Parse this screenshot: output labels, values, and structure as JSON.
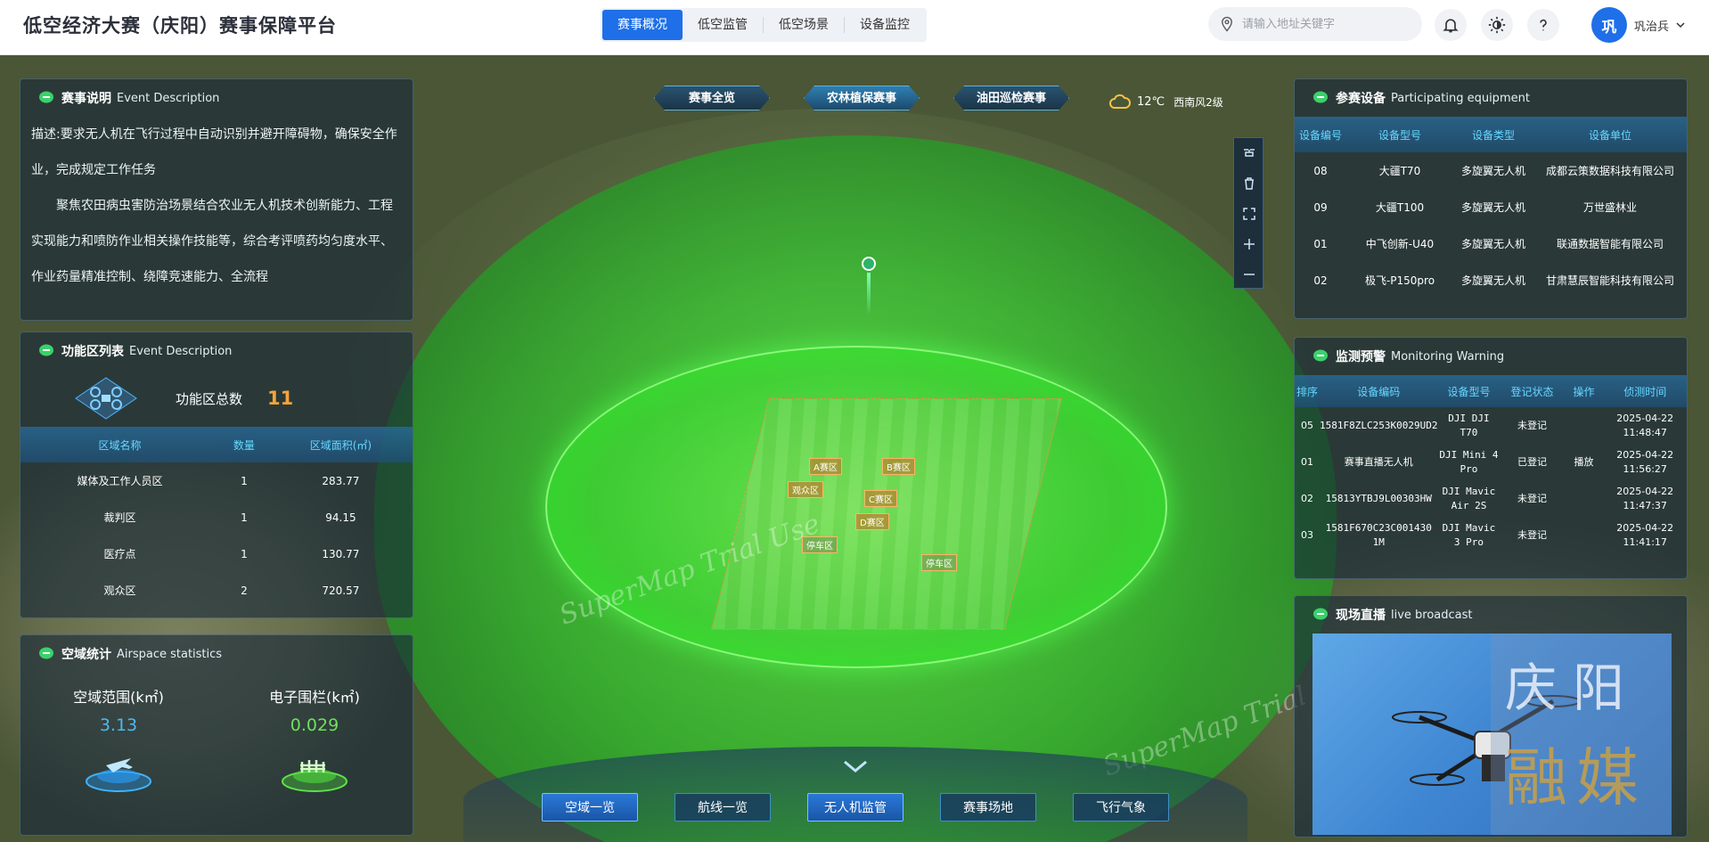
{
  "header": {
    "title": "低空经济大赛（庆阳）赛事保障平台",
    "nav": [
      {
        "label": "赛事概况",
        "active": true
      },
      {
        "label": "低空监管",
        "active": false
      },
      {
        "label": "低空场景",
        "active": false
      },
      {
        "label": "设备监控",
        "active": false
      }
    ],
    "search_placeholder": "请输入地址关键字",
    "user": {
      "avatar": "巩",
      "name": "巩治兵"
    }
  },
  "event_desc": {
    "title": "赛事说明",
    "title_en": "Event Description",
    "para1": "描述:要求无人机在飞行过程中自动识别并避开障碍物，确保安全作业，完成规定工作任务",
    "para2": "聚焦农田病虫害防治场景结合农业无人机技术创新能力、工程实现能力和喷防作业相关操作技能等，综合考评喷药均匀度水平、作业药量精准控制、绕障竞速能力、全流程"
  },
  "func_list": {
    "title": "功能区列表",
    "title_en": "Event Description",
    "total_label": "功能区总数",
    "total": "11",
    "columns": [
      "区域名称",
      "数量",
      "区域面积(㎡)"
    ],
    "rows": [
      [
        "媒体及工作人员区",
        "1",
        "283.77"
      ],
      [
        "裁判区",
        "1",
        "94.15"
      ],
      [
        "医疗点",
        "1",
        "130.77"
      ],
      [
        "观众区",
        "2",
        "720.57"
      ]
    ]
  },
  "airspace": {
    "title": "空域统计",
    "title_en": "Airspace statistics",
    "range_label": "空域范围(k㎡)",
    "range_value": "3.13",
    "fence_label": "电子围栏(k㎡)",
    "fence_value": "0.029",
    "colors": {
      "range": "#4fb8f0",
      "fence": "#6ee05a"
    }
  },
  "scene_tabs": [
    {
      "label": "赛事全览",
      "active": false
    },
    {
      "label": "农林植保赛事",
      "active": true
    },
    {
      "label": "油田巡检赛事",
      "active": false
    }
  ],
  "weather": {
    "temp": "12℃",
    "wind": "西南风2级"
  },
  "equipment": {
    "title": "参赛设备",
    "title_en": "Participating equipment",
    "columns": [
      "设备编号",
      "设备型号",
      "设备类型",
      "设备单位"
    ],
    "rows": [
      [
        "08",
        "大疆T70",
        "多旋翼无人机",
        "成都云策数据科技有限公司"
      ],
      [
        "09",
        "大疆T100",
        "多旋翼无人机",
        "万世盛林业"
      ],
      [
        "01",
        "中飞创新-U40",
        "多旋翼无人机",
        "联通数据智能有限公司"
      ],
      [
        "02",
        "极飞-P150pro",
        "多旋翼无人机",
        "甘肃慧辰智能科技有限公司"
      ]
    ]
  },
  "monitoring": {
    "title": "监测预警",
    "title_en": "Monitoring Warning",
    "columns": [
      "排序",
      "设备编码",
      "设备型号",
      "登记状态",
      "操作",
      "侦测时间"
    ],
    "rows": [
      [
        "05",
        "1581F8ZLC253K0029UD2",
        "DJI DJI T70",
        "未登记",
        "",
        "2025-04-22 11:48:47"
      ],
      [
        "01",
        "赛事直播无人机",
        "DJI Mini 4 Pro",
        "已登记",
        "播放",
        "2025-04-22 11:56:27"
      ],
      [
        "02",
        "15813YTBJ9L00303HW",
        "DJI Mavic Air 2S",
        "未登记",
        "",
        "2025-04-22 11:47:37"
      ],
      [
        "03",
        "1581F670C23C001430 1M",
        "DJI Mavic 3 Pro",
        "未登记",
        "",
        "2025-04-22 11:41:17"
      ]
    ]
  },
  "live": {
    "title": "现场直播",
    "title_en": "live broadcast",
    "overlay_line1": "庆阳",
    "overlay_line2": "融媒"
  },
  "bottom_buttons": [
    {
      "label": "空域一览",
      "active": true
    },
    {
      "label": "航线一览",
      "active": false
    },
    {
      "label": "无人机监管",
      "active": true
    },
    {
      "label": "赛事场地",
      "active": false
    },
    {
      "label": "飞行气象",
      "active": false
    }
  ],
  "map_labels": {
    "zone_a": "A赛区",
    "zone_b": "B赛区",
    "zone_c": "C赛区",
    "zone_d": "D赛区",
    "watch": "观众区",
    "park1": "停车区",
    "park2": "停车区",
    "watermark": "SuperMap Trial Use"
  },
  "icons": [
    "search-icon",
    "bell-icon",
    "theme-icon",
    "help-icon",
    "chevron-down-icon",
    "cloud-icon",
    "drone-icon",
    "trash-icon",
    "fullscreen-icon",
    "zoom-in-icon",
    "zoom-out-icon",
    "plane-icon",
    "fence-icon"
  ]
}
